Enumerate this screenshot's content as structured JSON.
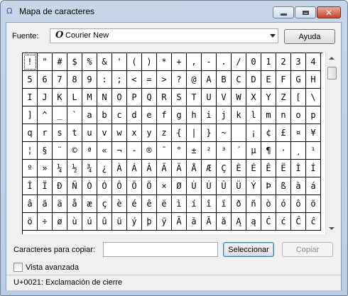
{
  "window": {
    "title": "Mapa de caracteres",
    "app_icon": "character-map-icon"
  },
  "controls": {
    "minimize_icon": "minimize-icon",
    "maximize_icon": "maximize-icon",
    "close_icon": "close-icon",
    "close_glyph": "✕"
  },
  "font": {
    "label": "Fuente:",
    "selected": "Courier New",
    "icon_glyph": "O",
    "icon": "opentype-font-icon"
  },
  "buttons": {
    "help": "Ayuda",
    "select": "Seleccionar",
    "copy": "Copiar"
  },
  "grid": {
    "selected_index": 0,
    "rows": [
      [
        "!",
        "\"",
        "#",
        "$",
        "%",
        "&",
        "'",
        "(",
        ")",
        "*",
        "+",
        ",",
        "-",
        ".",
        "/",
        "0",
        "1",
        "2",
        "3",
        "4"
      ],
      [
        "5",
        "6",
        "7",
        "8",
        "9",
        ":",
        ";",
        "<",
        "=",
        ">",
        "?",
        "@",
        "A",
        "B",
        "C",
        "D",
        "E",
        "F",
        "G",
        "H"
      ],
      [
        "I",
        "J",
        "K",
        "L",
        "M",
        "N",
        "O",
        "P",
        "Q",
        "R",
        "S",
        "T",
        "U",
        "V",
        "W",
        "X",
        "Y",
        "Z",
        "[",
        "\\"
      ],
      [
        "]",
        "^",
        "_",
        "`",
        "a",
        "b",
        "c",
        "d",
        "e",
        "f",
        "g",
        "h",
        "i",
        "j",
        "k",
        "l",
        "m",
        "n",
        "o",
        "p"
      ],
      [
        "q",
        "r",
        "s",
        "t",
        "u",
        "v",
        "w",
        "x",
        "y",
        "z",
        "{",
        "|",
        "}",
        "~",
        " ",
        "¡",
        "¢",
        "£",
        "¤",
        "¥"
      ],
      [
        "¦",
        "§",
        "¨",
        "©",
        "ª",
        "«",
        "¬",
        "-",
        "®",
        "¯",
        "°",
        "±",
        "²",
        "³",
        "´",
        "µ",
        "¶",
        "·",
        "¸",
        "¹"
      ],
      [
        "º",
        "»",
        "¼",
        "½",
        "¾",
        "¿",
        "À",
        "Á",
        "Â",
        "Ã",
        "Ä",
        "Å",
        "Æ",
        "Ç",
        "È",
        "É",
        "Ê",
        "Ë",
        "Ì",
        "Í"
      ],
      [
        "Î",
        "Ï",
        "Ð",
        "Ñ",
        "Ò",
        "Ó",
        "Ô",
        "Õ",
        "Ö",
        "×",
        "Ø",
        "Ù",
        "Ú",
        "Û",
        "Ü",
        "Ý",
        "Þ",
        "ß",
        "à",
        "á"
      ],
      [
        "â",
        "ã",
        "ä",
        "å",
        "æ",
        "ç",
        "è",
        "é",
        "ê",
        "ë",
        "ì",
        "í",
        "î",
        "ï",
        "ð",
        "ñ",
        "ò",
        "ó",
        "ô",
        "õ"
      ],
      [
        "ö",
        "÷",
        "ø",
        "ù",
        "ú",
        "û",
        "ü",
        "ý",
        "þ",
        "ÿ",
        "Ā",
        "ā",
        "Ă",
        "ă",
        "Ą",
        "ą",
        "Ć",
        "ć",
        "Ĉ",
        "ĉ"
      ]
    ]
  },
  "copy": {
    "label": "Caracteres para copiar:",
    "value": ""
  },
  "advanced": {
    "label": "Vista avanzada",
    "checked": false
  },
  "status": {
    "text": "U+0021: Exclamación de cierre"
  },
  "colors": {
    "title_gradient_top": "#c7d7ea",
    "close_button": "#c8442c",
    "client_bg": "#f0f0f0",
    "focus_border": "#3c7fb1"
  }
}
